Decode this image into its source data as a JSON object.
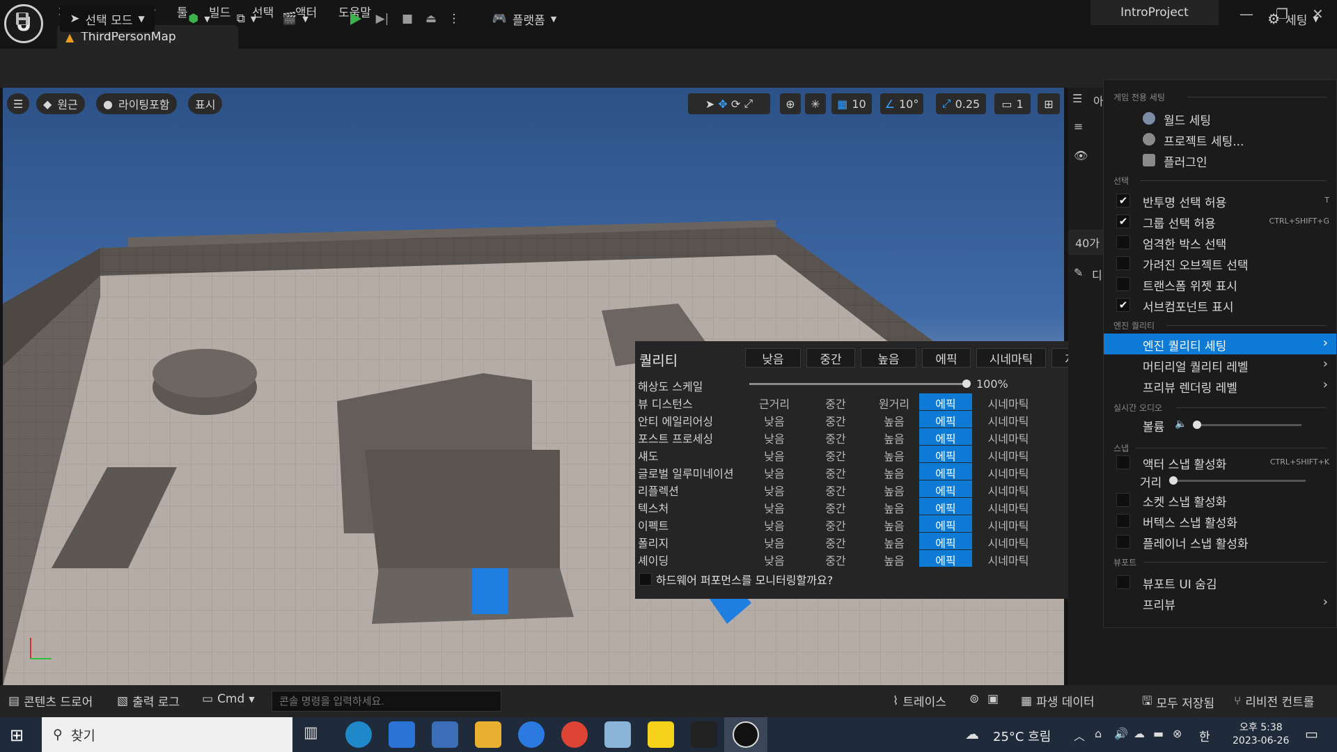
{
  "titlebar": {
    "menus": [
      "파일",
      "편집",
      "창",
      "툴",
      "빌드",
      "선택",
      "액터",
      "도움말"
    ],
    "map_tab": "ThirdPersonMap",
    "project_name": "IntroProject"
  },
  "toolbar": {
    "mode_label": "선택 모드",
    "platform_label": "플랫폼",
    "settings_label": "세팅"
  },
  "viewport": {
    "perspective_label": "원근",
    "lighting_label": "라이팅포함",
    "show_label": "표시",
    "grid_snap": "10",
    "rotation_snap": "10°",
    "scale_snap": "0.25",
    "camera_speed": "1"
  },
  "quality": {
    "title": "퀄리티",
    "presets": [
      "낮음",
      "중간",
      "높음",
      "에픽",
      "시네마틱",
      "자동"
    ],
    "resolution_label": "해상도 스케일",
    "resolution_value": "100%",
    "resolution_fraction": 1.0,
    "view_distance": {
      "label": "뷰 디스턴스",
      "options": [
        "근거리",
        "중간",
        "원거리",
        "에픽",
        "시네마틱"
      ]
    },
    "rows": [
      {
        "label": "안티 에일리어싱",
        "options": [
          "낮음",
          "중간",
          "높음",
          "에픽",
          "시네마틱"
        ]
      },
      {
        "label": "포스트 프로세싱",
        "options": [
          "낮음",
          "중간",
          "높음",
          "에픽",
          "시네마틱"
        ]
      },
      {
        "label": "섀도",
        "options": [
          "낮음",
          "중간",
          "높음",
          "에픽",
          "시네마틱"
        ]
      },
      {
        "label": "글로벌 일루미네이션",
        "options": [
          "낮음",
          "중간",
          "높음",
          "에픽",
          "시네마틱"
        ]
      },
      {
        "label": "리플렉션",
        "options": [
          "낮음",
          "중간",
          "높음",
          "에픽",
          "시네마틱"
        ]
      },
      {
        "label": "텍스처",
        "options": [
          "낮음",
          "중간",
          "높음",
          "에픽",
          "시네마틱"
        ]
      },
      {
        "label": "이펙트",
        "options": [
          "낮음",
          "중간",
          "높음",
          "에픽",
          "시네마틱"
        ]
      },
      {
        "label": "폴리지",
        "options": [
          "낮음",
          "중간",
          "높음",
          "에픽",
          "시네마틱"
        ]
      },
      {
        "label": "셰이딩",
        "options": [
          "낮음",
          "중간",
          "높음",
          "에픽",
          "시네마틱"
        ]
      }
    ],
    "monitor_label": "하드웨어 퍼포먼스를 모니터링할까요?"
  },
  "settings_menu": {
    "sec_game": "게임 전용 세팅",
    "world_settings": "월드 세팅",
    "project_settings": "프로젝트 세팅...",
    "plugins": "플러그인",
    "sec_select": "선택",
    "translucent": {
      "label": "반투명 선택 허용",
      "shortcut": "T",
      "checked": true
    },
    "group": {
      "label": "그룹 선택 허용",
      "shortcut": "CTRL+SHIFT+G",
      "checked": true
    },
    "strict_box": {
      "label": "엄격한 박스 선택",
      "checked": false
    },
    "occluded": {
      "label": "가려진 오브젝트 선택",
      "checked": false
    },
    "transform_widget": {
      "label": "트랜스폼 위젯 표시",
      "checked": false
    },
    "subcomponents": {
      "label": "서브컴포넌트 표시",
      "checked": true
    },
    "sec_quality": "엔진 퀄리티",
    "engine_quality": "엔진 퀄리티 세팅",
    "material_quality": "머티리얼 퀄리티 레벨",
    "preview_rendering": "프리뷰 렌더링 레벨",
    "sec_audio": "실시간 오디오",
    "volume_label": "볼륨",
    "volume_level": 0.0,
    "sec_snap": "스냅",
    "actor_snap": {
      "label": "액터 스냅 활성화",
      "shortcut": "CTRL+SHIFT+K",
      "checked": false
    },
    "distance_label": "거리",
    "distance_level": 0.0,
    "socket_snap": {
      "label": "소켓 스냅 활성화",
      "checked": false
    },
    "vertex_snap": {
      "label": "버텍스 스냅 활성화",
      "checked": false
    },
    "planar_snap": {
      "label": "플레이너 스냅 활성화",
      "checked": false
    },
    "sec_viewport": "뷰포트",
    "hide_ui": {
      "label": "뷰포트 UI 숨김",
      "checked": false
    },
    "preview": "프리뷰"
  },
  "right_panel": {
    "outliner_partial": "아",
    "count_partial": "40가",
    "details_partial": "디"
  },
  "bottombar": {
    "content_drawer": "콘텐츠 드로어",
    "output_log": "출력 로그",
    "cmd": "Cmd",
    "console_placeholder": "콘솔 명령을 입력하세요.",
    "trace": "트레이스",
    "derived_data": "파생 데이터",
    "all_saved": "모두 저장됨",
    "revision_control": "리비전 컨트롤"
  },
  "taskbar": {
    "search_label": "찾기",
    "weather": "25°C 흐림",
    "ime": "한",
    "time": "오후 5:38",
    "date": "2023-06-26"
  },
  "colors": {
    "accent": "#0d7ad6",
    "play_green": "#3bb34a"
  }
}
